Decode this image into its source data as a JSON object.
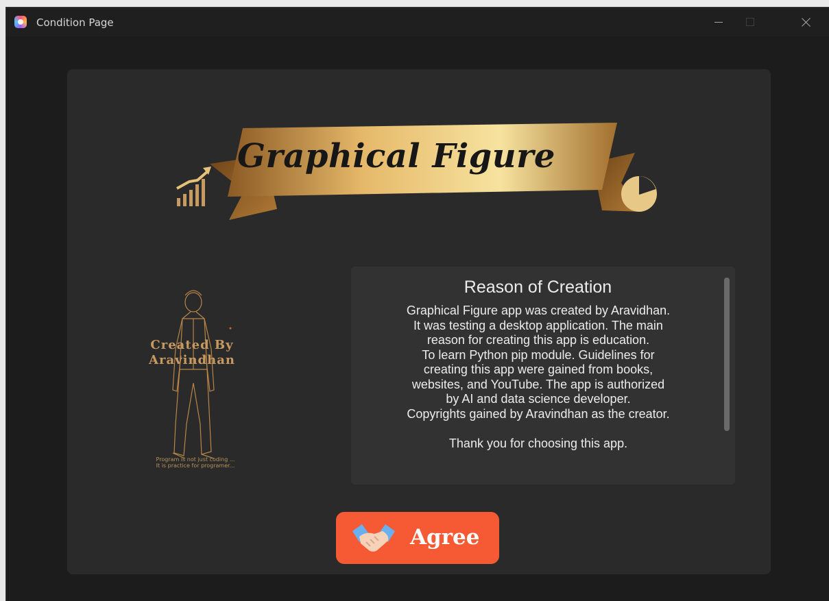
{
  "window": {
    "title": "Condition Page"
  },
  "banner": {
    "title": "Graphical Figure"
  },
  "creator": {
    "line1": "Created By",
    "line2": "Aravindhan",
    "tagline_line1": "Program is not just coding ...",
    "tagline_line2": "It is practice for programer..."
  },
  "reason": {
    "title": "Reason of Creation",
    "lines": [
      "Graphical Figure app was created by Aravidhan.",
      "It was testing a desktop application. The main",
      "reason for creating this app is education.",
      "To learn Python pip module. Guidelines for",
      "creating this app were gained from books,",
      "websites, and YouTube. The app is authorized",
      "by AI and data science developer.",
      "Copyrights gained by Aravindhan as the creator."
    ],
    "thanks": "Thank you for choosing this app."
  },
  "agree_button": {
    "label": "Agree",
    "icon": "handshake-icon"
  },
  "colors": {
    "button_bg": "#f55a34",
    "gold": "#c79a62",
    "panel_bg": "#2a2a2a",
    "window_bg": "#1c1c1c"
  }
}
